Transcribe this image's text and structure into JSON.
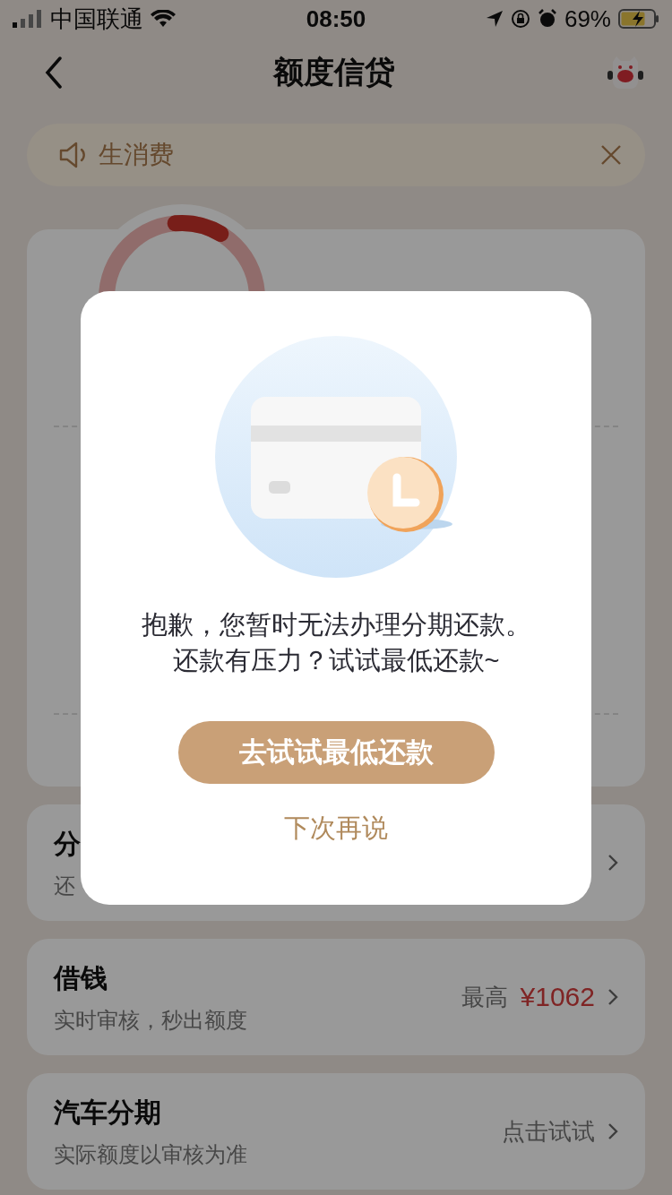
{
  "status_bar": {
    "carrier": "中国联通",
    "time": "08:50",
    "battery": "69%"
  },
  "nav": {
    "title": "额度信贷"
  },
  "notice": {
    "text": "生消费"
  },
  "credit_card": {
    "level": 0.1
  },
  "rows": [
    {
      "title": "分",
      "subtitle": "还"
    },
    {
      "title": "借钱",
      "subtitle": "实时审核，秒出额度",
      "note": "最高",
      "amount": "¥1062"
    },
    {
      "title": "汽车分期",
      "subtitle": "实际额度以审核为准",
      "note": "点击试试"
    }
  ],
  "dialog": {
    "lines": [
      "抱歉，您暂时无法办理分期还款。",
      "还款有压力？试试最低还款~"
    ],
    "primary": "去试试最低还款",
    "secondary": "下次再说"
  }
}
